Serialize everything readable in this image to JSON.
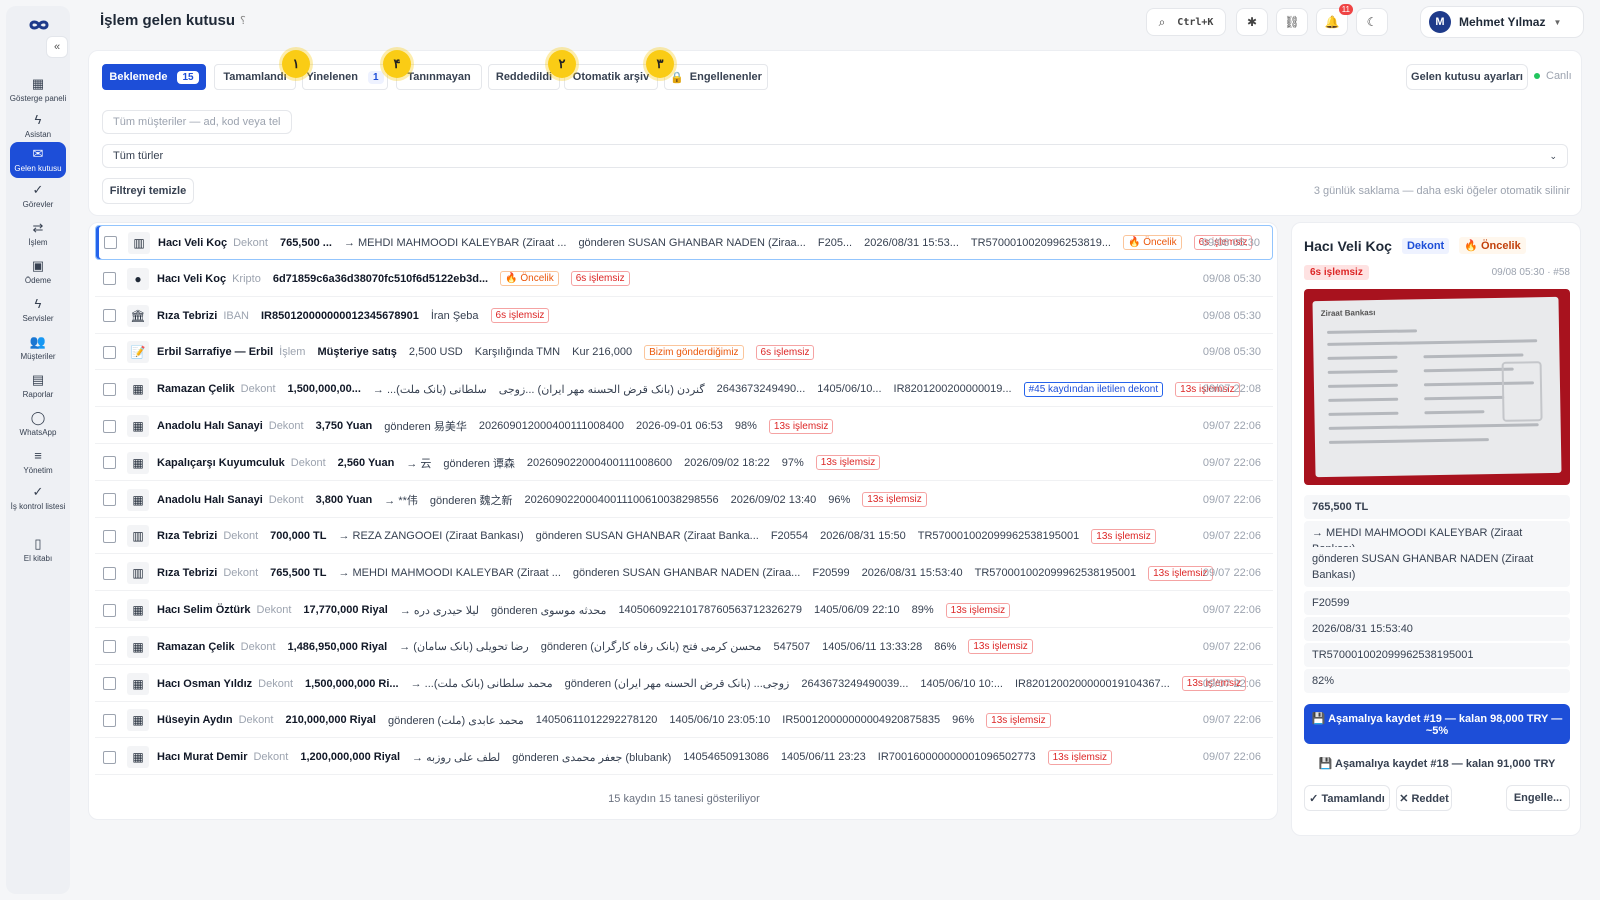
{
  "app": {
    "title": "İşlem gelen kutusu",
    "help": "؟"
  },
  "sidebar": {
    "collapse": "«",
    "items": [
      {
        "label": "Gösterge paneli",
        "icon": "grid-icon"
      },
      {
        "label": "Asistan",
        "icon": "bolt-icon"
      },
      {
        "label": "Gelen kutusu",
        "icon": "inbox-icon"
      },
      {
        "label": "Görevler",
        "icon": "check-icon"
      },
      {
        "label": "İşlem",
        "icon": "swap-icon"
      },
      {
        "label": "Ödeme",
        "icon": "wallet-icon"
      },
      {
        "label": "Servisler",
        "icon": "bolt-icon"
      },
      {
        "label": "Müşteriler",
        "icon": "users-icon"
      },
      {
        "label": "Raporlar",
        "icon": "report-icon"
      },
      {
        "label": "WhatsApp",
        "icon": "chat-icon"
      },
      {
        "label": "Yönetim",
        "icon": "sliders-icon"
      },
      {
        "label": "İş kontrol listesi",
        "icon": "check-icon"
      },
      {
        "label": "El kitabı",
        "icon": "book-icon"
      }
    ]
  },
  "header": {
    "search_shortcut": "Ctrl+K",
    "notif_count": "11",
    "user_initial": "M",
    "user_name": "Mehmet Yılmaz"
  },
  "tabs": [
    {
      "label": "Beklemede",
      "count": "15"
    },
    {
      "label": "Tamamlandı"
    },
    {
      "label": "Yinelenen",
      "count": "1"
    },
    {
      "label": "Tanınmayan"
    },
    {
      "label": "Reddedildi"
    },
    {
      "label": "Otomatik arşiv"
    },
    {
      "label": "Engellenenler"
    }
  ],
  "annotations": [
    "١",
    "۴",
    "٢",
    "٣"
  ],
  "settings_button": "Gelen kutusu ayarları",
  "live": "Canlı",
  "filters": {
    "customer_placeholder": "Tüm müşteriler — ad, kod veya tel",
    "type_select": "Tüm türler",
    "clear": "Filtreyi temizle",
    "retention": "3 günlük saklama — daha eski öğeler otomatik silinir"
  },
  "rows": [
    {
      "name": "Hacı Veli Koç",
      "type": "Dekont",
      "f": [
        "765,500 ...",
        "→ MEHDI MAHMOODI KALEYBAR (Ziraat ...",
        "gönderen SUSAN GHANBAR NADEN (Ziraa...",
        "F205...",
        "2026/08/31 15:53...",
        "TR5700010020996253819..."
      ],
      "tags": [
        "🔥 Öncelik",
        "6s işlemsiz"
      ],
      "time": "09/08 05:30"
    },
    {
      "name": "Hacı Veli Koç",
      "type": "Kripto",
      "f": [
        "6d71859c6a36d38070fc510f6d5122eb3d..."
      ],
      "tags": [
        "🔥 Öncelik",
        "6s işlemsiz"
      ],
      "time": "09/08 05:30"
    },
    {
      "name": "Rıza Tebrizi",
      "type": "IBAN",
      "f": [
        "IR850120000000012345678901",
        "İran Şeba"
      ],
      "tags": [
        "6s işlemsiz"
      ],
      "time": "09/08 05:30"
    },
    {
      "name": "Erbil Sarrafiye — Erbil",
      "type": "İşlem",
      "f": [
        "Müşteriye satış",
        "2,500 USD",
        "Karşılığında TMN",
        "Kur 216,000"
      ],
      "tags": [
        "Bizim gönderdiğimiz",
        "6s işlemsiz"
      ],
      "time": "09/08 05:30"
    },
    {
      "name": "Ramazan Çelik",
      "type": "Dekont",
      "f": [
        "1,500,000,00...",
        "→ ...سلطانی (بانک ملت)",
        "گنردن (بانک قرض الحسنه مهر ایران) ...زوجی",
        "2643673249490...",
        "1405/06/10...",
        "IR8201200200000019..."
      ],
      "tags": [
        "#45 kaydından iletilen dekont",
        "13s işlemsiz"
      ],
      "time": "09/07 22:08"
    },
    {
      "name": "Anadolu Halı Sanayi",
      "type": "Dekont",
      "f": [
        "3,750 Yuan",
        "gönderen 易美华",
        "20260901200040011100840​0",
        "2026-09-01 06:53",
        "98%"
      ],
      "tags": [
        "13s işlemsiz"
      ],
      "time": "09/07 22:06"
    },
    {
      "name": "Kapalıçarşı Kuyumculuk",
      "type": "Dekont",
      "f": [
        "2,560 Yuan",
        "→ 云",
        "gönderen 谭森",
        "20260902200040011100860​0",
        "2026/09/02 18:22",
        "97%"
      ],
      "tags": [
        "13s işlemsiz"
      ],
      "time": "09/07 22:06"
    },
    {
      "name": "Anadolu Halı Sanayi",
      "type": "Dekont",
      "f": [
        "3,800 Yuan",
        "→ **伟",
        "gönderen 魏之新",
        "202609022000400111006100382985​56",
        "2026/09/02 13:40",
        "96%"
      ],
      "tags": [
        "13s işlemsiz"
      ],
      "time": "09/07 22:06"
    },
    {
      "name": "Rıza Tebrizi",
      "type": "Dekont",
      "f": [
        "700,000 TL",
        "→ REZA ZANGOOEI (Ziraat Bankası)",
        "gönderen SUSAN GHANBAR (Ziraat Banka...",
        "F20554",
        "2026/08/31 15:50",
        "TR570001002099962538195001"
      ],
      "tags": [
        "13s işlemsiz"
      ],
      "time": "09/07 22:06"
    },
    {
      "name": "Rıza Tebrizi",
      "type": "Dekont",
      "f": [
        "765,500 TL",
        "→ MEHDI MAHMOODI KALEYBAR (Ziraat ...",
        "gönderen SUSAN GHANBAR NADEN (Ziraa...",
        "F20599",
        "2026/08/31 15:53:40",
        "TR570001002099962538195001"
      ],
      "tags": [
        "13s işlemsiz"
      ],
      "time": "09/07 22:06"
    },
    {
      "name": "Hacı Selim Öztürk",
      "type": "Dekont",
      "f": [
        "17,770,000 Riyal",
        "→ لیلا حیدری دره",
        "gönderen محدثه موسوی",
        "140506092210178760563712326279",
        "1405/06/09 22:10",
        "89%"
      ],
      "tags": [
        "13s işlemsiz"
      ],
      "time": "09/07 22:06"
    },
    {
      "name": "Ramazan Çelik",
      "type": "Dekont",
      "f": [
        "1,486,950,000 Riyal",
        "→ رضا تحویلی (بانک سامان)",
        "gönderen محسن کرمی فتح (بانک رفاه کارگران)",
        "547507",
        "1405/06/11 13:33:28",
        "86%"
      ],
      "tags": [
        "13s işlemsiz"
      ],
      "time": "09/07 22:06"
    },
    {
      "name": "Hacı Osman Yıldız",
      "type": "Dekont",
      "f": [
        "1,500,000,000 Ri...",
        "→ ...محمد سلطانی (بانک ملت)",
        "gönderen (بانک قرض الحسنه مهر ایران) ...زوجی",
        "2643673249490039...",
        "1405/06/10 10:...",
        "IR8201200200000019104367..."
      ],
      "tags": [
        "13s işlemsiz"
      ],
      "time": "09/07 22:06"
    },
    {
      "name": "Hüseyin Aydın",
      "type": "Dekont",
      "f": [
        "210,000,000 Riyal",
        "gönderen محمد عابدی (ملت)",
        "14050611012292278120",
        "1405/06/10 23:05:10",
        "IR500120000000004920875835",
        "96%"
      ],
      "tags": [
        "13s işlemsiz"
      ],
      "time": "09/07 22:06"
    },
    {
      "name": "Hacı Murat Demir",
      "type": "Dekont",
      "f": [
        "1,200,000,000 Riyal",
        "→ لطف علی روزبه",
        "gönderen جعفر محمدی (blubank)",
        "14054650913086",
        "1405/06/11 23:23",
        "IR700160000000001096502773"
      ],
      "tags": [
        "13s işlemsiz"
      ],
      "time": "09/07 22:06"
    }
  ],
  "list_footer": "15 kaydın 15 tanesi gösteriliyor",
  "detail": {
    "name": "Hacı Veli Koç",
    "type": "Dekont",
    "priority": "🔥 Öncelik",
    "idle": "6s işlemsiz",
    "meta": "09/08 05:30 · #58",
    "lines": [
      "765,500 TL",
      "→ MEHDI MAHMOODI KALEYBAR (Ziraat Bankası)",
      "gönderen SUSAN GHANBAR NADEN (Ziraat Bankası)",
      "F20599",
      "2026/08/31 15:53:40",
      "TR570001002099962538195001",
      "82%"
    ],
    "receipt_bank": "Ziraat Bankası",
    "save1": "💾 Aşamalıya kaydet #19 — kalan 98,000 TRY — ~5%",
    "save2": "💾 Aşamalıya kaydet #18 — kalan 91,000 TRY",
    "done": "✓ Tamamlandı",
    "reject": "✕ Reddet",
    "block": "Engelle..."
  }
}
